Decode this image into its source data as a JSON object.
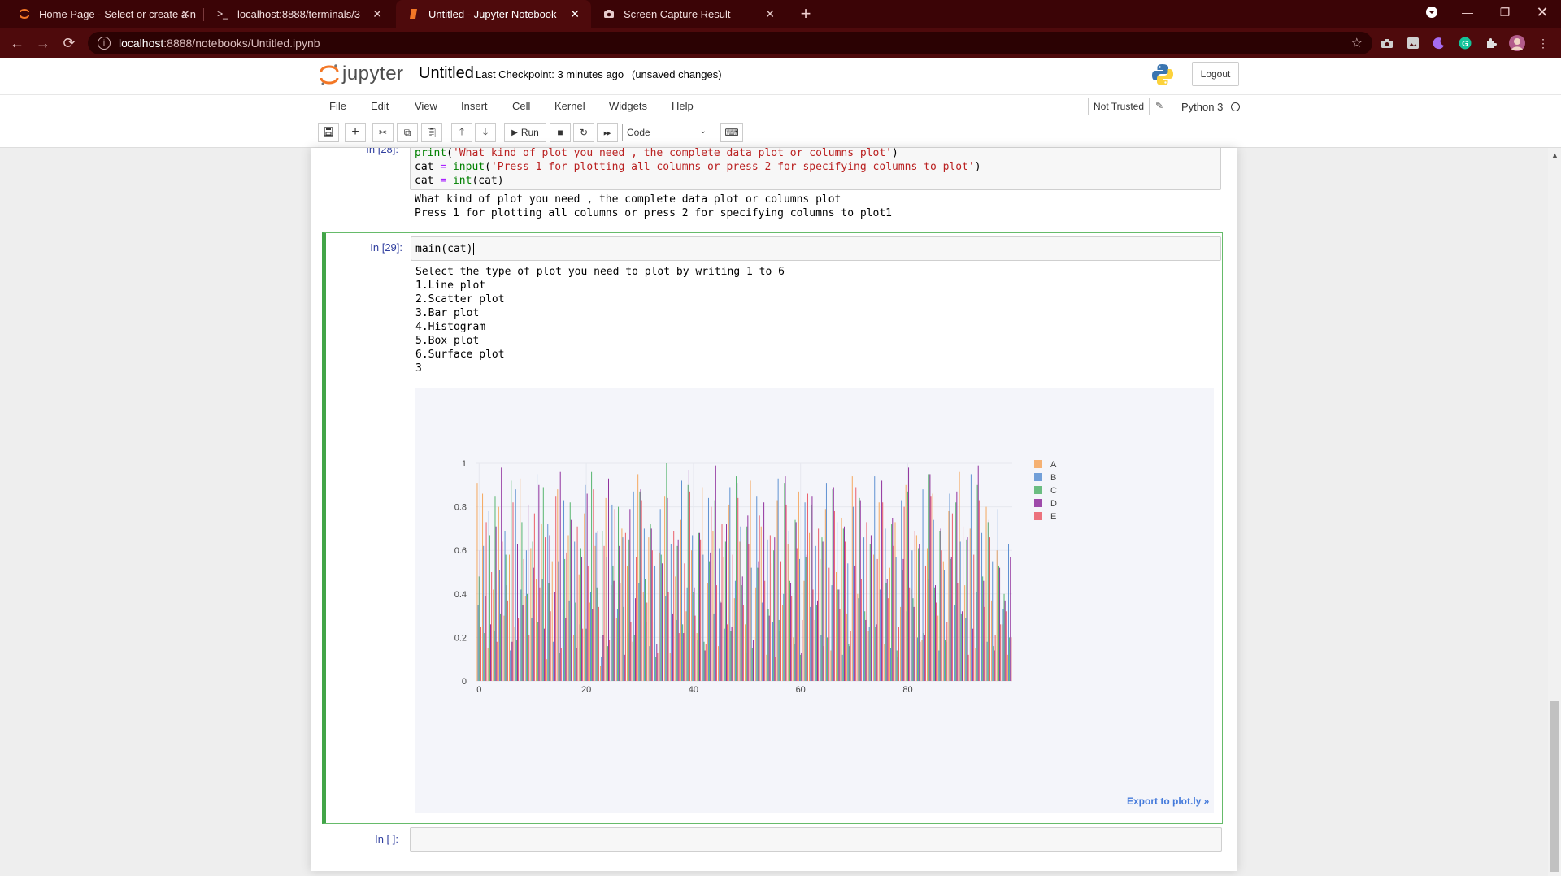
{
  "browser": {
    "tabs": [
      {
        "title": "Home Page - Select or create a n",
        "icon": "jupyter-icon"
      },
      {
        "title": "localhost:8888/terminals/3",
        "icon": "terminal-icon"
      },
      {
        "title": "Untitled - Jupyter Notebook",
        "icon": "notebook-icon",
        "active": true
      },
      {
        "title": "Screen Capture Result",
        "icon": "camera-icon"
      }
    ],
    "url_host": "localhost",
    "url_path": ":8888/notebooks/Untitled.ipynb"
  },
  "header": {
    "logo_text": "jupyter",
    "notebook_name": "Untitled",
    "checkpoint": "Last Checkpoint: 3 minutes ago",
    "unsaved": "(unsaved changes)",
    "logout_label": "Logout"
  },
  "menu": {
    "items": [
      "File",
      "Edit",
      "View",
      "Insert",
      "Cell",
      "Kernel",
      "Widgets",
      "Help"
    ],
    "trust_label": "Not Trusted",
    "kernel_name": "Python 3"
  },
  "toolbar": {
    "run_label": "Run",
    "cell_type": "Code"
  },
  "cells": {
    "c28": {
      "prompt": "In [28]:",
      "code_line1": "print('What kind of plot you need , the complete data plot or columns plot')",
      "code_line2_var": "cat",
      "code_line2_fn": "input",
      "code_line2_str": "'Press 1 for plotting all columns or press 2 for specifying columns to plot'",
      "code_line3_var": "cat",
      "code_line3_fn": "int",
      "code_line3_arg": "(cat)",
      "output": [
        "What kind of plot you need , the complete data plot or columns plot",
        "Press 1 for plotting all columns or press 2 for specifying columns to plot1"
      ]
    },
    "c29": {
      "prompt": "In [29]:",
      "code": "main(cat)",
      "output": [
        "Select the type of plot you need to plot by writing 1 to 6",
        "1.Line plot",
        "2.Scatter plot",
        "3.Bar plot",
        "4.Histogram",
        "5.Box plot",
        "6.Surface plot",
        "3"
      ],
      "export_link": "Export to plot.ly »"
    },
    "empty": {
      "prompt": "In [ ]:"
    }
  },
  "chart_data": {
    "type": "bar",
    "title": "",
    "xlabel": "",
    "ylabel": "",
    "xlim": [
      0,
      99
    ],
    "ylim": [
      0,
      1
    ],
    "x_ticks": [
      "0",
      "20",
      "40",
      "60",
      "80"
    ],
    "y_ticks": [
      "0",
      "0.2",
      "0.4",
      "0.6",
      "0.8",
      "1"
    ],
    "legend_position": "top-right",
    "grid": true,
    "series": [
      {
        "name": "A",
        "color": "#f5a55a",
        "values": [
          0.91,
          0.86,
          0.15,
          0.42,
          0.8,
          0.3,
          0.58,
          0.25,
          0.93,
          0.39,
          0.61,
          0.47,
          0.72,
          0.1,
          0.55,
          0.88,
          0.33,
          0.67,
          0.21,
          0.49,
          0.77,
          0.36,
          0.62,
          0.07,
          0.84,
          0.44,
          0.29,
          0.7,
          0.53,
          0.18,
          0.95,
          0.41,
          0.66,
          0.27,
          0.59,
          0.85,
          0.13,
          0.48,
          0.74,
          0.32,
          0.6,
          0.22,
          0.89,
          0.45,
          0.69,
          0.16,
          0.57,
          0.81,
          0.38,
          0.64,
          0.26,
          0.92,
          0.43,
          0.71,
          0.12,
          0.54,
          0.83,
          0.35,
          0.63,
          0.2,
          0.87,
          0.46,
          0.68,
          0.28,
          0.56,
          0.79,
          0.14,
          0.5,
          0.75,
          0.31,
          0.94,
          0.4,
          0.65,
          0.23,
          0.58,
          0.82,
          0.17,
          0.52,
          0.73,
          0.34,
          0.9,
          0.42,
          0.67,
          0.19,
          0.61,
          0.86,
          0.3,
          0.55,
          0.78,
          0.24,
          0.96,
          0.44,
          0.7,
          0.15,
          0.53,
          0.8,
          0.37,
          0.6,
          0.26,
          0.12
        ]
      },
      {
        "name": "B",
        "color": "#5b8fd1",
        "values": [
          0.35,
          0.62,
          0.78,
          0.23,
          0.51,
          0.69,
          0.14,
          0.88,
          0.42,
          0.6,
          0.29,
          0.95,
          0.47,
          0.72,
          0.18,
          0.55,
          0.83,
          0.37,
          0.64,
          0.26,
          0.9,
          0.41,
          0.68,
          0.11,
          0.57,
          0.81,
          0.33,
          0.66,
          0.22,
          0.87,
          0.45,
          0.7,
          0.16,
          0.53,
          0.79,
          0.39,
          0.63,
          0.28,
          0.92,
          0.43,
          0.67,
          0.19,
          0.58,
          0.84,
          0.31,
          0.61,
          0.24,
          0.89,
          0.46,
          0.71,
          0.13,
          0.52,
          0.85,
          0.36,
          0.65,
          0.27,
          0.93,
          0.4,
          0.69,
          0.17,
          0.56,
          0.82,
          0.34,
          0.62,
          0.21,
          0.91,
          0.44,
          0.73,
          0.12,
          0.54,
          0.8,
          0.38,
          0.66,
          0.25,
          0.94,
          0.42,
          0.7,
          0.15,
          0.57,
          0.83,
          0.32,
          0.6,
          0.2,
          0.88,
          0.47,
          0.74,
          0.14,
          0.51,
          0.86,
          0.35,
          0.64,
          0.29,
          0.95,
          0.41,
          0.68,
          0.18,
          0.55,
          0.79,
          0.33,
          0.63
        ]
      },
      {
        "name": "C",
        "color": "#52b36b",
        "values": [
          0.48,
          0.22,
          0.67,
          0.85,
          0.31,
          0.58,
          0.92,
          0.19,
          0.73,
          0.4,
          0.64,
          0.27,
          0.89,
          0.45,
          0.7,
          0.13,
          0.56,
          0.82,
          0.36,
          0.61,
          0.24,
          0.96,
          0.43,
          0.69,
          0.16,
          0.53,
          0.8,
          0.34,
          0.65,
          0.21,
          0.87,
          0.47,
          0.72,
          0.11,
          0.58,
          1.0,
          0.3,
          0.62,
          0.26,
          0.9,
          0.41,
          0.68,
          0.18,
          0.55,
          0.83,
          0.37,
          0.64,
          0.23,
          0.94,
          0.44,
          0.71,
          0.15,
          0.52,
          0.86,
          0.33,
          0.6,
          0.28,
          0.91,
          0.46,
          0.74,
          0.12,
          0.57,
          0.81,
          0.35,
          0.66,
          0.2,
          0.88,
          0.42,
          0.7,
          0.17,
          0.54,
          0.84,
          0.32,
          0.63,
          0.25,
          0.93,
          0.45,
          0.72,
          0.14,
          0.51,
          0.87,
          0.38,
          0.61,
          0.22,
          0.95,
          0.43,
          0.69,
          0.19,
          0.56,
          0.82,
          0.31,
          0.65,
          0.27,
          0.9,
          0.48,
          0.73,
          0.16,
          0.53,
          0.4,
          0.2
        ]
      },
      {
        "name": "D",
        "color": "#8e2c9b",
        "values": [
          0.6,
          0.39,
          0.26,
          0.71,
          0.98,
          0.44,
          0.18,
          0.63,
          0.35,
          0.81,
          0.52,
          0.9,
          0.24,
          0.67,
          0.41,
          0.96,
          0.29,
          0.74,
          0.15,
          0.57,
          0.86,
          0.33,
          0.69,
          0.21,
          0.93,
          0.46,
          0.62,
          0.12,
          0.79,
          0.38,
          0.88,
          0.27,
          0.7,
          0.17,
          0.54,
          0.84,
          0.31,
          0.65,
          0.22,
          0.97,
          0.43,
          0.68,
          0.14,
          0.59,
          0.99,
          0.36,
          0.72,
          0.25,
          0.91,
          0.48,
          0.76,
          0.19,
          0.55,
          0.82,
          0.3,
          0.66,
          0.23,
          0.94,
          0.45,
          0.73,
          0.13,
          0.58,
          0.85,
          0.37,
          0.64,
          0.2,
          0.89,
          0.42,
          0.71,
          0.16,
          0.53,
          0.83,
          0.28,
          0.67,
          0.26,
          0.92,
          0.47,
          0.75,
          0.11,
          0.56,
          0.98,
          0.34,
          0.63,
          0.21,
          0.95,
          0.44,
          0.7,
          0.18,
          0.57,
          0.87,
          0.32,
          0.66,
          0.24,
          0.99,
          0.46,
          0.74,
          0.14,
          0.52,
          0.37,
          0.57
        ]
      },
      {
        "name": "E",
        "color": "#ea5a66",
        "values": [
          0.25,
          0.73,
          0.5,
          0.18,
          0.64,
          0.37,
          0.82,
          0.29,
          0.56,
          0.21,
          0.77,
          0.43,
          0.66,
          0.32,
          0.85,
          0.15,
          0.59,
          0.4,
          0.71,
          0.24,
          0.53,
          0.88,
          0.34,
          0.62,
          0.19,
          0.79,
          0.45,
          0.68,
          0.27,
          0.57,
          0.83,
          0.36,
          0.6,
          0.13,
          0.75,
          0.41,
          0.69,
          0.22,
          0.54,
          0.87,
          0.3,
          0.65,
          0.17,
          0.8,
          0.44,
          0.72,
          0.26,
          0.58,
          0.84,
          0.35,
          0.63,
          0.2,
          0.76,
          0.46,
          0.67,
          0.11,
          0.55,
          0.81,
          0.39,
          0.61,
          0.28,
          0.86,
          0.42,
          0.7,
          0.16,
          0.52,
          0.78,
          0.33,
          0.64,
          0.23,
          0.89,
          0.47,
          0.73,
          0.14,
          0.56,
          0.82,
          0.38,
          0.62,
          0.25,
          0.8,
          0.43,
          0.69,
          0.18,
          0.53,
          0.85,
          0.36,
          0.6,
          0.27,
          0.77,
          0.45,
          0.71,
          0.12,
          0.58,
          0.83,
          0.34,
          0.66,
          0.21,
          0.26,
          0.32,
          0.2
        ]
      }
    ]
  }
}
